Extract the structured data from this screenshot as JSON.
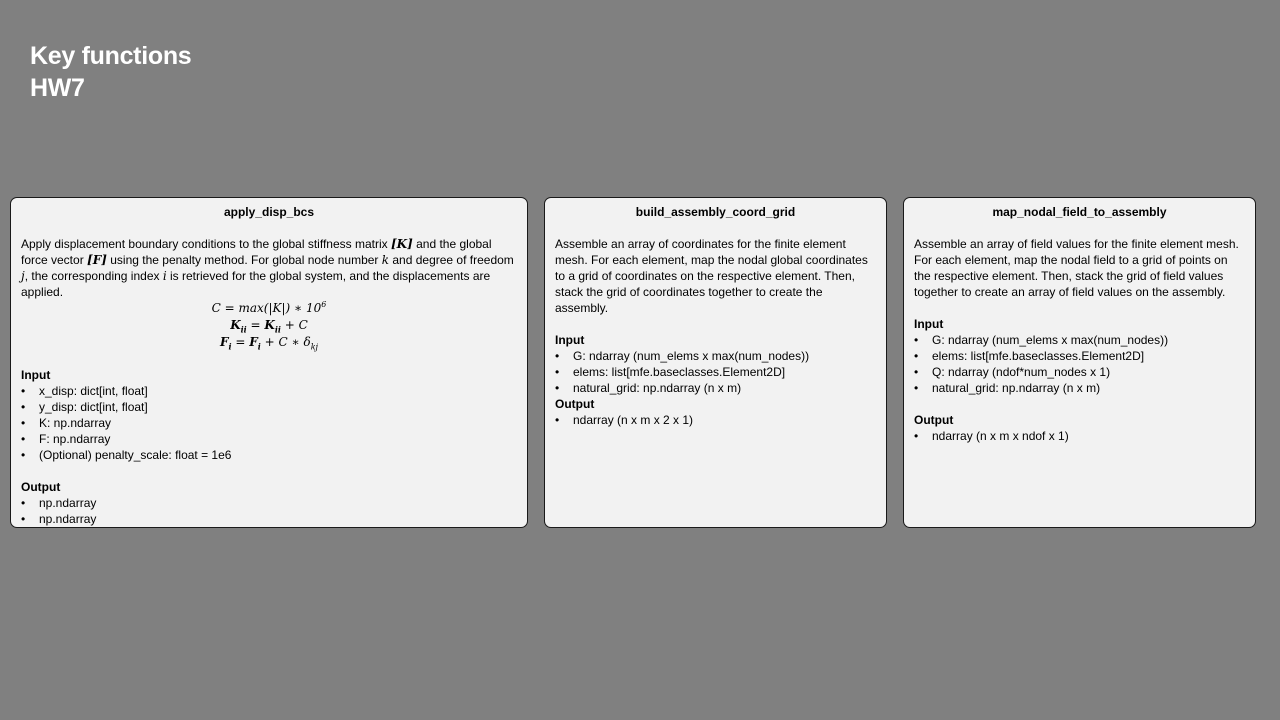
{
  "slide": {
    "title_line1": "Key functions",
    "title_line2": "HW7"
  },
  "cards": [
    {
      "title": "apply_disp_bcs",
      "desc": {
        "p1": "Apply displacement boundary conditions to the global stiffness matrix ",
        "K_bracket": "[K]",
        "p2": " and the global force vector ",
        "F_bracket": "[F]",
        "p3": " using the penalty method. For global node number ",
        "k": "k",
        "p4": " and degree of freedom ",
        "j": "j",
        "p5": ", the corresponding index ",
        "i": "i",
        "p6": " is retrieved for the global system, and the displacements are applied."
      },
      "equations": {
        "eq1": "C = max(|K|) ∗ 10",
        "eq1_sup": "6",
        "eq2_lhs": "K",
        "eq2_lhs_sub": "ii",
        "eq2_mid": " = ",
        "eq2_rhs": "K",
        "eq2_rhs_sub": "ii",
        "eq2_tail": " + C",
        "eq3_lhs": "F",
        "eq3_lhs_sub": "i",
        "eq3_mid": " = ",
        "eq3_rhs": "F",
        "eq3_rhs_sub": "i",
        "eq3_tail": " + C ∗ δ",
        "eq3_tail_sub": "kj"
      },
      "input_heading": "Input",
      "inputs": [
        "x_disp: dict[int, float]",
        "y_disp: dict[int, float]",
        "K: np.ndarray",
        "F: np.ndarray",
        "(Optional) penalty_scale: float = 1e6"
      ],
      "output_heading": "Output",
      "outputs": [
        "np.ndarray",
        "np.ndarray"
      ]
    },
    {
      "title": "build_assembly_coord_grid",
      "desc": "Assemble an array of coordinates for the finite element mesh. For each element, map the nodal global coordinates to a grid of coordinates on the respective element. Then, stack the grid of coordinates together to create the assembly.",
      "input_heading": "Input",
      "inputs": [
        "G: ndarray (num_elems x max(num_nodes))",
        "elems: list[mfe.baseclasses.Element2D]",
        "natural_grid: np.ndarray (n x m)"
      ],
      "output_heading": "Output",
      "outputs": [
        "ndarray (n x m x 2 x 1)"
      ]
    },
    {
      "title": "map_nodal_field_to_assembly",
      "desc": "Assemble an array of field values for the finite element mesh. For each element, map the nodal field to a grid of points on the respective element. Then, stack the grid of field values together to create an array of field values on the assembly.",
      "input_heading": "Input",
      "inputs": [
        "G: ndarray (num_elems x max(num_nodes))",
        "elems: list[mfe.baseclasses.Element2D]",
        "Q: ndarray (ndof*num_nodes x 1)",
        "natural_grid: np.ndarray (n x m)"
      ],
      "output_heading": "Output",
      "outputs": [
        "ndarray (n x m x ndof x 1)"
      ]
    }
  ]
}
